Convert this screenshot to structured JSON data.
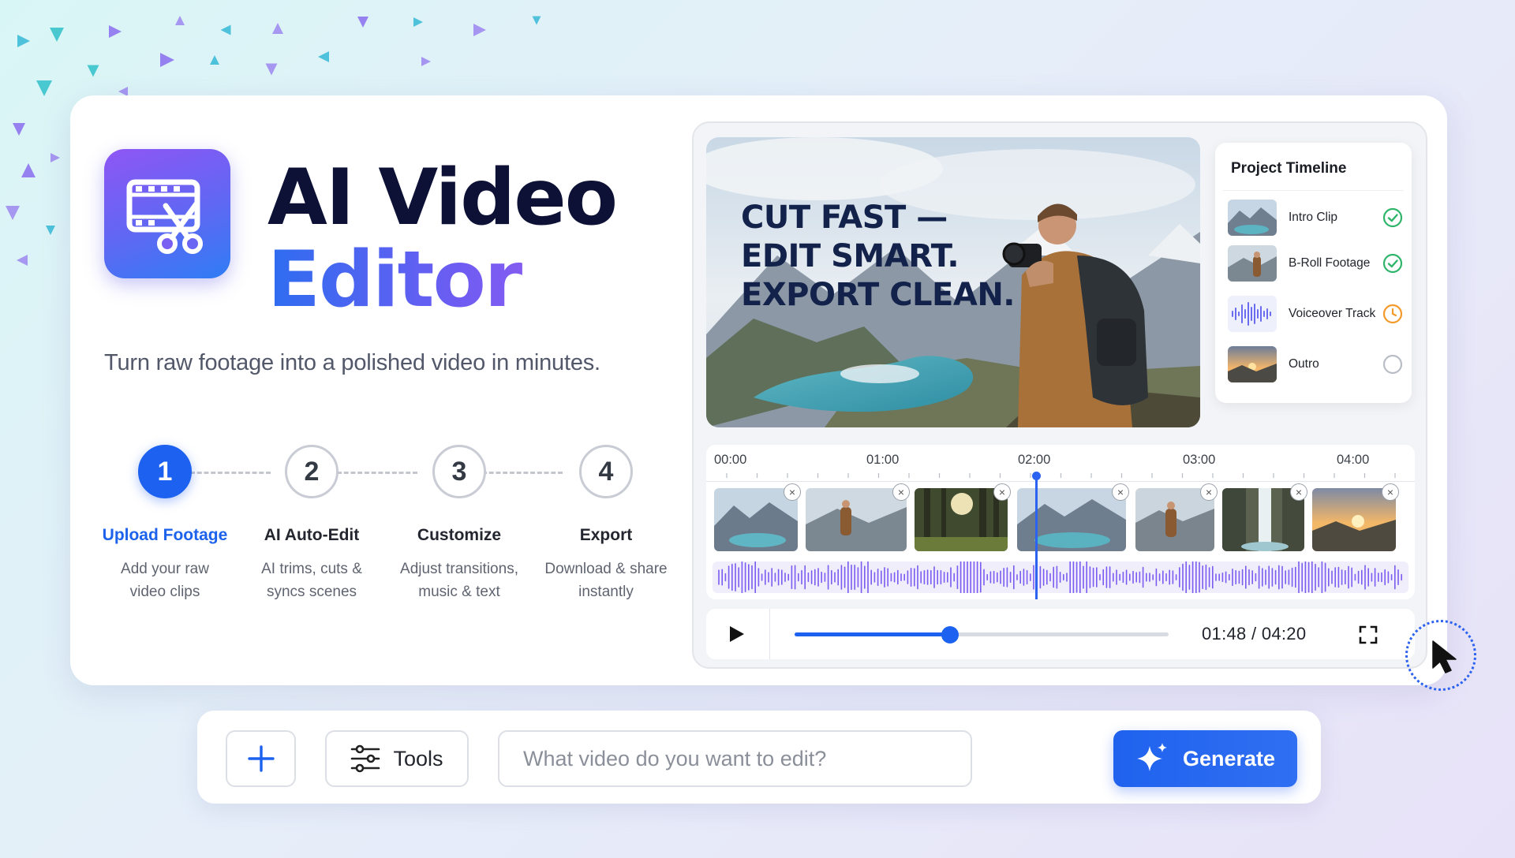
{
  "hero": {
    "title_line1": "AI Video",
    "title_line2": "Editor",
    "subtitle": "Turn raw footage into a polished video in minutes.",
    "logo_icon": "film-scissors-icon"
  },
  "steps": [
    {
      "number": "1",
      "title": "Upload Footage",
      "desc1": "Add your raw",
      "desc2": "video clips",
      "active": true
    },
    {
      "number": "2",
      "title": "AI Auto-Edit",
      "desc1": "AI trims, cuts &",
      "desc2": "syncs scenes",
      "active": false
    },
    {
      "number": "3",
      "title": "Customize",
      "desc1": "Adjust transitions,",
      "desc2": "music & text",
      "active": false
    },
    {
      "number": "4",
      "title": "Export",
      "desc1": "Download & share",
      "desc2": "instantly",
      "active": false
    }
  ],
  "preview": {
    "overlay_line1": "CUT FAST —",
    "overlay_line2": "EDIT SMART.",
    "overlay_line3": "EXPORT CLEAN."
  },
  "project_timeline": {
    "title": "Project Timeline",
    "items": [
      {
        "label": "Intro Clip",
        "status": "done"
      },
      {
        "label": "B-Roll Footage",
        "status": "done"
      },
      {
        "label": "Voiceover Track",
        "status": "in-progress"
      },
      {
        "label": "Outro",
        "status": "pending"
      }
    ]
  },
  "timeline": {
    "ruler": [
      "00:00",
      "01:00",
      "02:00",
      "03:00",
      "04:00"
    ],
    "clip_close_glyph": "×"
  },
  "player": {
    "current_time": "01:48",
    "separator": "/",
    "total_time": "04:20",
    "progress_fraction": 0.415
  },
  "prompt_bar": {
    "add_icon": "plus-icon",
    "tools_label": "Tools",
    "input_placeholder": "What video do you want to edit?",
    "generate_label": "Generate"
  },
  "colors": {
    "accent": "#1c61ef",
    "status_done": "#2fb56a",
    "status_in_progress": "#f39a2b",
    "status_pending": "#b9bdc6",
    "waveform": "#7a5cf0"
  }
}
